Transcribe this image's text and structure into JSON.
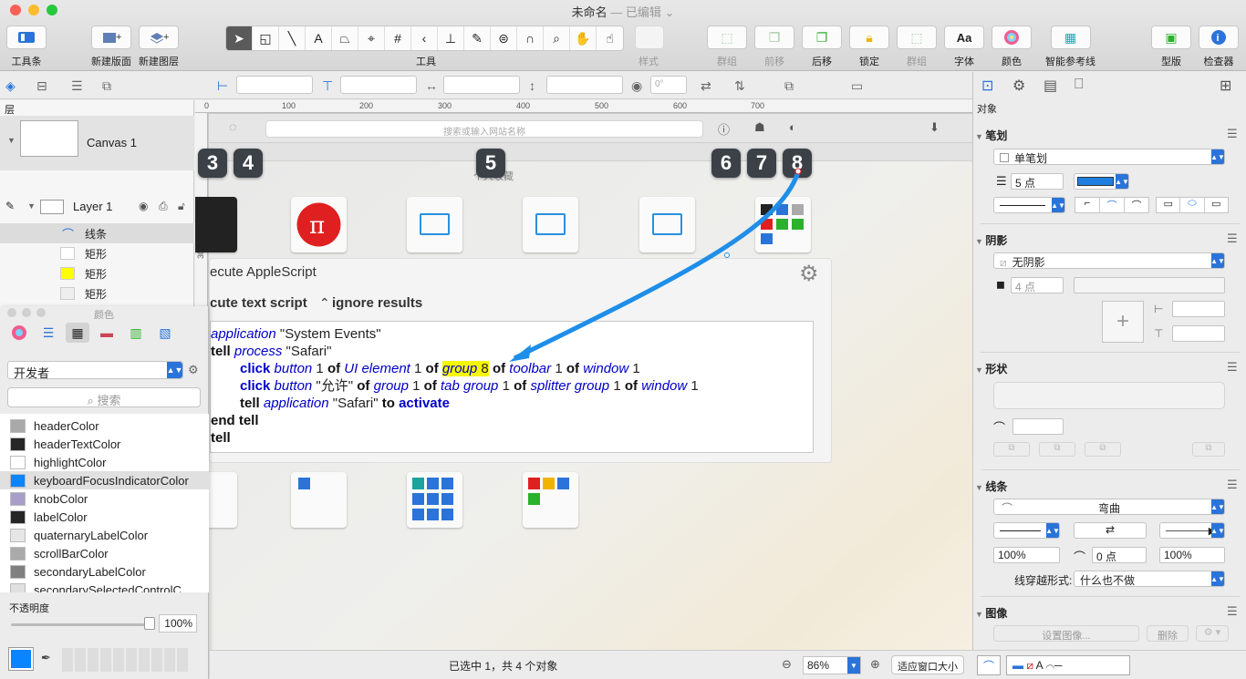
{
  "window": {
    "title": "未命名",
    "subtitle": "— 已编辑 ⌄"
  },
  "toolbar": {
    "left": [
      {
        "label": "工具条"
      },
      {
        "label": "新建版面"
      },
      {
        "label": "新建图层"
      }
    ],
    "tools_label": "工具",
    "style_label": "样式",
    "right": [
      {
        "label": "群组",
        "enabled": false
      },
      {
        "label": "前移",
        "enabled": false
      },
      {
        "label": "后移",
        "enabled": true
      },
      {
        "label": "锁定",
        "enabled": true
      },
      {
        "label": "群组",
        "enabled": false
      },
      {
        "label": "字体",
        "enabled": true
      },
      {
        "label": "颜色",
        "enabled": true
      },
      {
        "label": "智能参考线",
        "enabled": true
      },
      {
        "label": "型版",
        "enabled": true
      },
      {
        "label": "检查器",
        "enabled": true
      }
    ]
  },
  "inspector_bar": {
    "rotation": "0°"
  },
  "sidebar": {
    "section_label": "层",
    "canvas_name": "Canvas 1",
    "layer_name": "Layer 1",
    "objects": [
      {
        "label": "线条",
        "swatch": ""
      },
      {
        "label": "矩形",
        "swatch": "#ffffff"
      },
      {
        "label": "矩形",
        "swatch": "#ffff00"
      },
      {
        "label": "矩形",
        "swatch": "#eeeeee"
      }
    ]
  },
  "color_panel": {
    "title": "颜色",
    "palette": "开发者",
    "search_placeholder": "搜索",
    "items": [
      {
        "name": "headerColor",
        "color": "#a9a9a9"
      },
      {
        "name": "headerTextColor",
        "color": "#262626"
      },
      {
        "name": "highlightColor",
        "color": "#ffffff"
      },
      {
        "name": "keyboardFocusIndicatorColor",
        "color": "#0a84ff",
        "selected": true
      },
      {
        "name": "knobColor",
        "color": "#a89ec9"
      },
      {
        "name": "labelColor",
        "color": "#262626"
      },
      {
        "name": "quaternaryLabelColor",
        "color": "#e6e6e6"
      },
      {
        "name": "scrollBarColor",
        "color": "#aaaaaa"
      },
      {
        "name": "secondaryLabelColor",
        "color": "#808080"
      },
      {
        "name": "secondarySelectedControlC...",
        "color": "#e0e0e0"
      }
    ],
    "opacity_label": "不透明度",
    "opacity": "100%",
    "opacity_value": 1.0,
    "current_color": "#0a84ff"
  },
  "canvas": {
    "ruler_ticks": [
      "0",
      "100",
      "200",
      "300",
      "400",
      "500",
      "600",
      "700"
    ],
    "ruler_left_ticks": [
      "300"
    ],
    "screenshot": {
      "url_placeholder": "搜索或输入网站名称",
      "badges": [
        "3",
        "4",
        "5",
        "6",
        "7",
        "8"
      ],
      "fav_label": "个人收藏",
      "panel_title": "ecute AppleScript",
      "panel_sub1": "cute text script",
      "panel_sub2": "ignore results",
      "code": [
        "application \"System Events\"",
        "tell process \"Safari\"",
        "click button 1 of UI element 1 of group 8 of toolbar 1 of window 1",
        "click button \"允许\" of group 1 of tab group 1 of splitter group 1 of window 1",
        "tell application \"Safari\" to activate",
        "end tell",
        "tell"
      ]
    }
  },
  "status": {
    "text": "已选中 1，共 4 个对象",
    "zoom": "86%",
    "fit_label": "适应窗口大小"
  },
  "inspector": {
    "object_label": "对象",
    "stroke": {
      "title": "笔划",
      "type": "单笔划",
      "width": "5 点",
      "color": "#1f7fe0"
    },
    "shadow": {
      "title": "阴影",
      "type": "无阴影",
      "size": "4 点"
    },
    "shape": {
      "title": "形状"
    },
    "line": {
      "title": "线条",
      "type": "弯曲",
      "start_scale": "100%",
      "corner": "0 点",
      "end_scale": "100%",
      "crossing_label": "线穿越形式:",
      "crossing_value": "什么也不做"
    },
    "image": {
      "title": "图像",
      "set_image": "设置图像...",
      "delete": "删除"
    }
  }
}
